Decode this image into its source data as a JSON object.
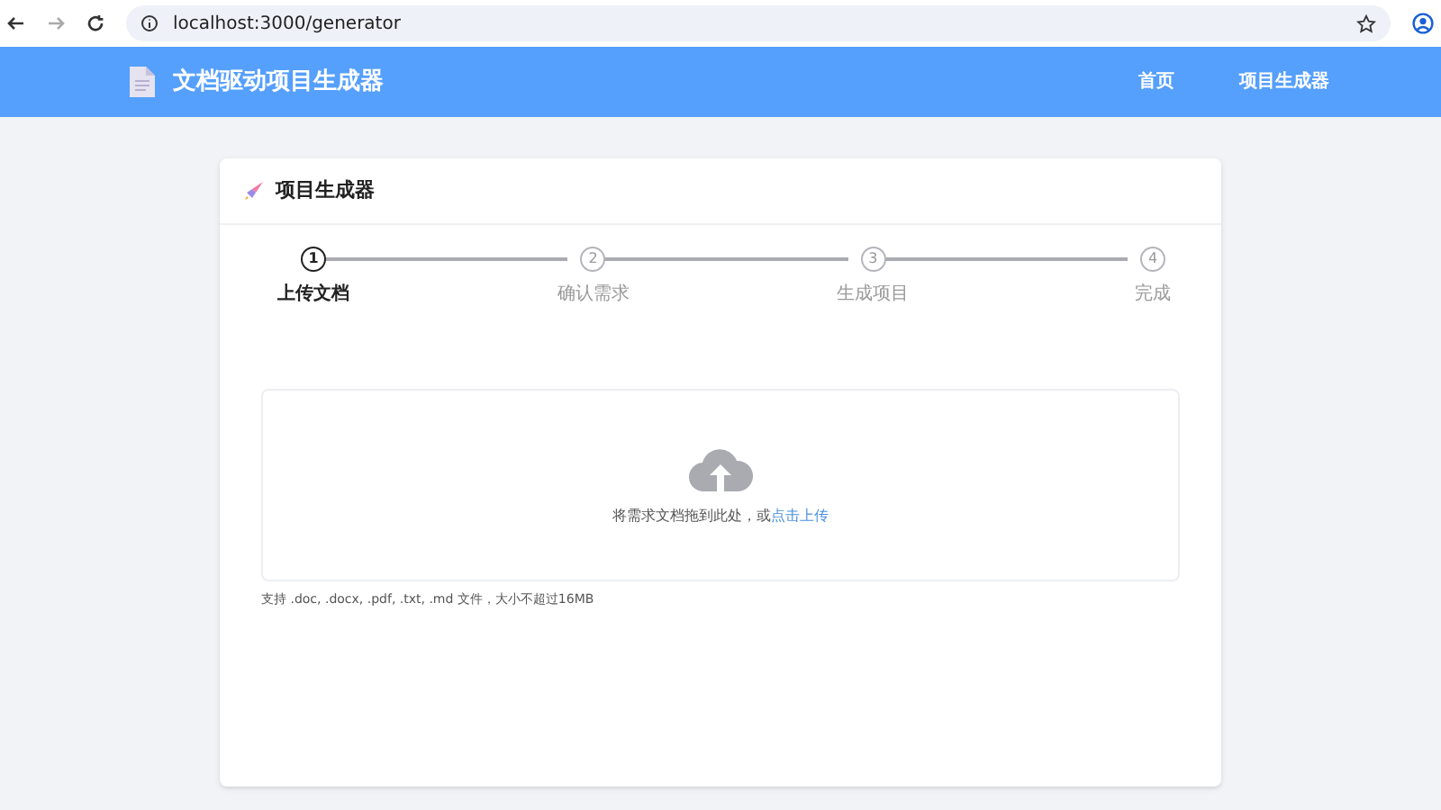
{
  "browser": {
    "url": "localhost:3000/generator"
  },
  "header": {
    "title": "文档驱动项目生成器",
    "nav": [
      {
        "label": "首页"
      },
      {
        "label": "项目生成器"
      }
    ]
  },
  "card": {
    "title": "项目生成器",
    "steps": [
      {
        "number": "1",
        "label": "上传文档",
        "selected": true
      },
      {
        "number": "2",
        "label": "确认需求",
        "selected": false
      },
      {
        "number": "3",
        "label": "生成项目",
        "selected": false
      },
      {
        "number": "4",
        "label": "完成",
        "selected": false
      }
    ],
    "upload": {
      "prompt": "将需求文档拖到此处，或",
      "link": "点击上传"
    },
    "hint": "支持 .doc, .docx, .pdf, .txt, .md 文件，大小不超过16MB"
  }
}
